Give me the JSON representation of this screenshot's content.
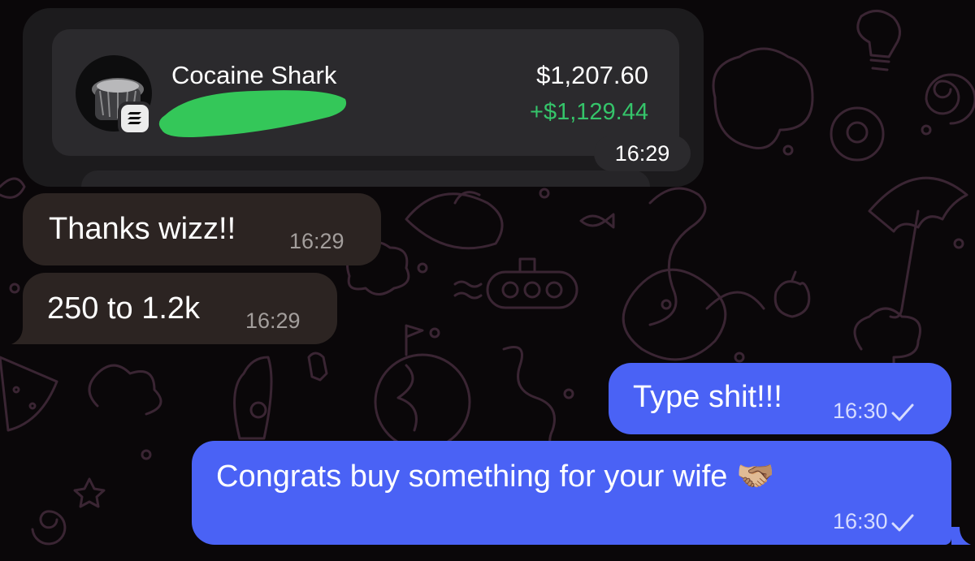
{
  "token_card": {
    "token_name": "Cocaine Shark",
    "value": "$1,207.60",
    "pnl": "+$1,129.44",
    "time": "16:29",
    "pnl_color": "#35c46a",
    "redaction_color": "#34c759",
    "chain_icon": "solana-icon"
  },
  "messages": [
    {
      "direction": "incoming",
      "text": "Thanks wizz!!",
      "time": "16:29"
    },
    {
      "direction": "incoming",
      "text": "250 to 1.2k",
      "time": "16:29"
    },
    {
      "direction": "outgoing",
      "text": "Type shit!!!",
      "time": "16:30",
      "status": "sent-check-icon"
    },
    {
      "direction": "outgoing",
      "text": "Congrats buy something for your wife 🫱🏼‍🫲🏽",
      "time": "16:30",
      "status": "sent-check-icon"
    }
  ],
  "colors": {
    "background": "#0a0709",
    "incoming_bubble": "#2c2422",
    "outgoing_bubble": "#4a62f5",
    "wallpaper_doodle": "#3a2533"
  }
}
